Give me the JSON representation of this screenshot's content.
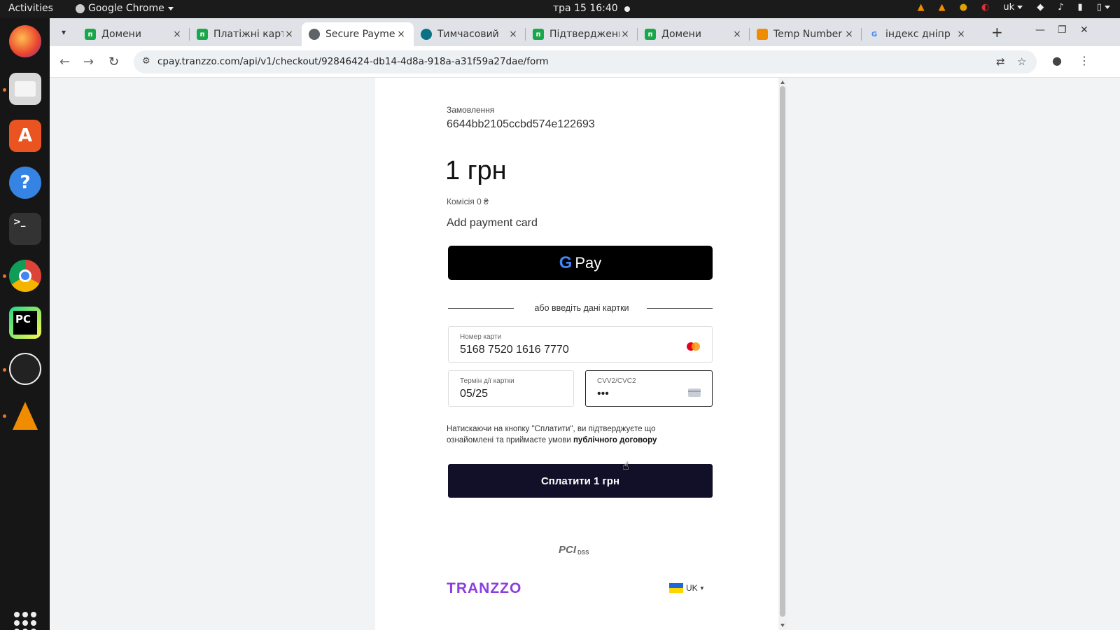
{
  "system": {
    "activities": "Activities",
    "app_menu": "Google Chrome",
    "clock": "тра 15  16:40",
    "tray_language": "uk"
  },
  "browser": {
    "tabs": [
      {
        "title": "Домени",
        "favicon": "p-green",
        "color": "#1aa64a",
        "active": false
      },
      {
        "title": "Платіжні карти",
        "favicon": "p-green",
        "color": "#1aa64a",
        "active": false
      },
      {
        "title": "Secure Payment",
        "favicon": "globe",
        "color": "#5f6368",
        "active": true
      },
      {
        "title": "Тимчасовий",
        "favicon": "circle-teal",
        "color": "#0b7285",
        "active": false
      },
      {
        "title": "Підтвердження",
        "favicon": "p-green",
        "color": "#1aa64a",
        "active": false
      },
      {
        "title": "Домени",
        "favicon": "p-green",
        "color": "#1aa64a",
        "active": false
      },
      {
        "title": "Temp Number",
        "favicon": "orange-square",
        "color": "#f08c00",
        "active": false
      },
      {
        "title": "індекс дніпр",
        "favicon": "google-g",
        "color": "#4285f4",
        "active": false
      }
    ],
    "url": "cpay.tranzzo.com/api/v1/checkout/92846424-db14-4d8a-918a-a31f59a27dae/form"
  },
  "checkout": {
    "order_label": "Замовлення",
    "order_id": "6644bb2105ccbd574e122693",
    "amount": "1 грн",
    "fee": "Комісія 0 ₴",
    "add_card": "Add payment card",
    "gpay_g": "G",
    "gpay_label": "Pay",
    "divider_text": "або введіть дані картки",
    "card_number_label": "Номер карти",
    "card_number_value": "5168 7520 1616 7770",
    "expiry_label": "Термін дії картки",
    "expiry_value": "05/25",
    "cvv_label": "CVV2/CVC2",
    "cvv_value": "•••",
    "terms_text": "Натискаючи на кнопку \"Сплатити\", ви підтверджуєте що ознайомлені та приймаєте умови",
    "terms_link": "публічного договору",
    "pay_button": "Сплатити 1 грн",
    "pci_mark": "PCI",
    "pci_dss": "DSS",
    "brand": "TRANZZO",
    "language": "UK"
  },
  "colors": {
    "pay_button_bg": "#121029",
    "brand_purple": "#8a3ee0",
    "gpay_bg": "#000000"
  }
}
